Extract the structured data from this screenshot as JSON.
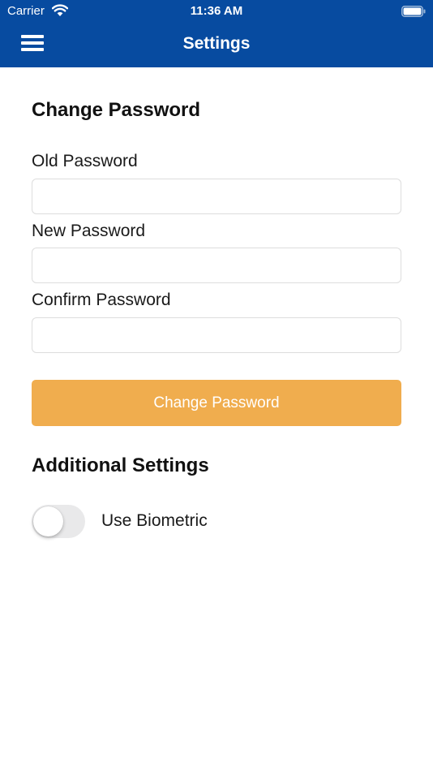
{
  "status_bar": {
    "carrier": "Carrier",
    "time": "11:36 AM",
    "wifi_icon": "wifi-icon",
    "battery_icon": "battery-icon"
  },
  "header": {
    "title": "Settings",
    "menu_icon": "hamburger-menu-icon",
    "background": "#074ba0"
  },
  "change_password": {
    "heading": "Change Password",
    "old_label": "Old Password",
    "old_value": "",
    "new_label": "New Password",
    "new_value": "",
    "confirm_label": "Confirm Password",
    "confirm_value": "",
    "button_label": "Change Password",
    "button_color": "#f0ad4e"
  },
  "additional_settings": {
    "heading": "Additional Settings",
    "biometric_label": "Use Biometric",
    "biometric_enabled": false
  }
}
